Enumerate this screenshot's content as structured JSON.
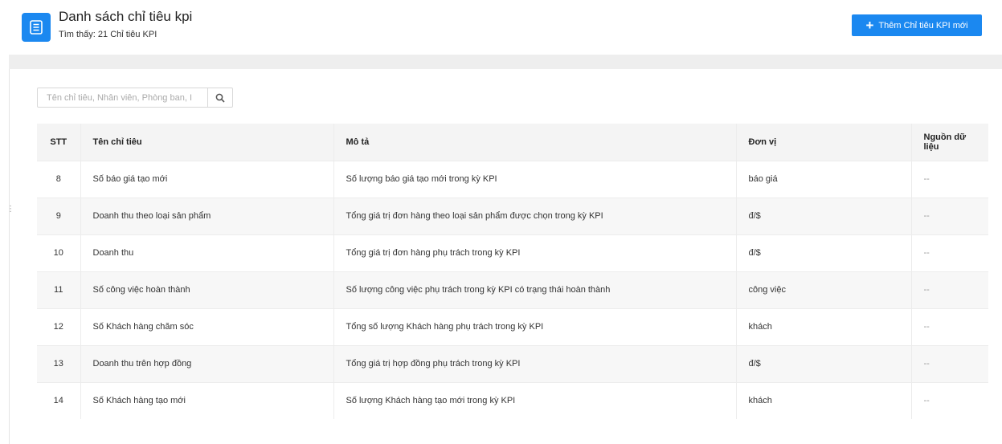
{
  "header": {
    "title": "Danh sách chỉ tiêu kpi",
    "subtitle": "Tìm thấy: 21 Chỉ tiêu KPI",
    "add_button_label": "Thêm Chỉ tiêu KPI mới"
  },
  "search": {
    "placeholder": "Tên chỉ tiêu, Nhân viên, Phòng ban, I",
    "value": ""
  },
  "table": {
    "columns": [
      "STT",
      "Tên chỉ tiêu",
      "Mô tả",
      "Đơn vị",
      "Nguồn dữ liệu"
    ],
    "rows": [
      {
        "stt": "8",
        "name": "Số báo giá tạo mới",
        "description": "Số lượng báo giá tạo mới trong kỳ KPI",
        "unit": "báo giá",
        "source": "--"
      },
      {
        "stt": "9",
        "name": "Doanh thu theo loại sản phẩm",
        "description": "Tổng giá trị đơn hàng theo loại sản phẩm được chọn trong kỳ KPI",
        "unit": "đ/$",
        "source": "--"
      },
      {
        "stt": "10",
        "name": "Doanh thu",
        "description": "Tổng giá trị đơn hàng phụ trách trong kỳ KPI",
        "unit": "đ/$",
        "source": "--"
      },
      {
        "stt": "11",
        "name": "Số công việc hoàn thành",
        "description": "Số lượng công việc phụ trách trong kỳ KPI có trạng thái hoàn thành",
        "unit": "công việc",
        "source": "--"
      },
      {
        "stt": "12",
        "name": "Số Khách hàng chăm sóc",
        "description": "Tổng số lượng Khách hàng phụ trách trong kỳ KPI",
        "unit": "khách",
        "source": "--"
      },
      {
        "stt": "13",
        "name": "Doanh thu trên hợp đồng",
        "description": "Tổng giá trị hợp đồng phụ trách trong kỳ KPI",
        "unit": "đ/$",
        "source": "--"
      },
      {
        "stt": "14",
        "name": "Số Khách hàng tạo mới",
        "description": "Số lượng Khách hàng tạo mới trong kỳ KPI",
        "unit": "khách",
        "source": "--"
      }
    ]
  },
  "colors": {
    "accent": "#1b88f0",
    "header_bg": "#f4f4f4",
    "band": "#eeeeee"
  },
  "icons": {
    "header": "list-document-icon",
    "add": "plus-icon",
    "search": "search-icon"
  }
}
